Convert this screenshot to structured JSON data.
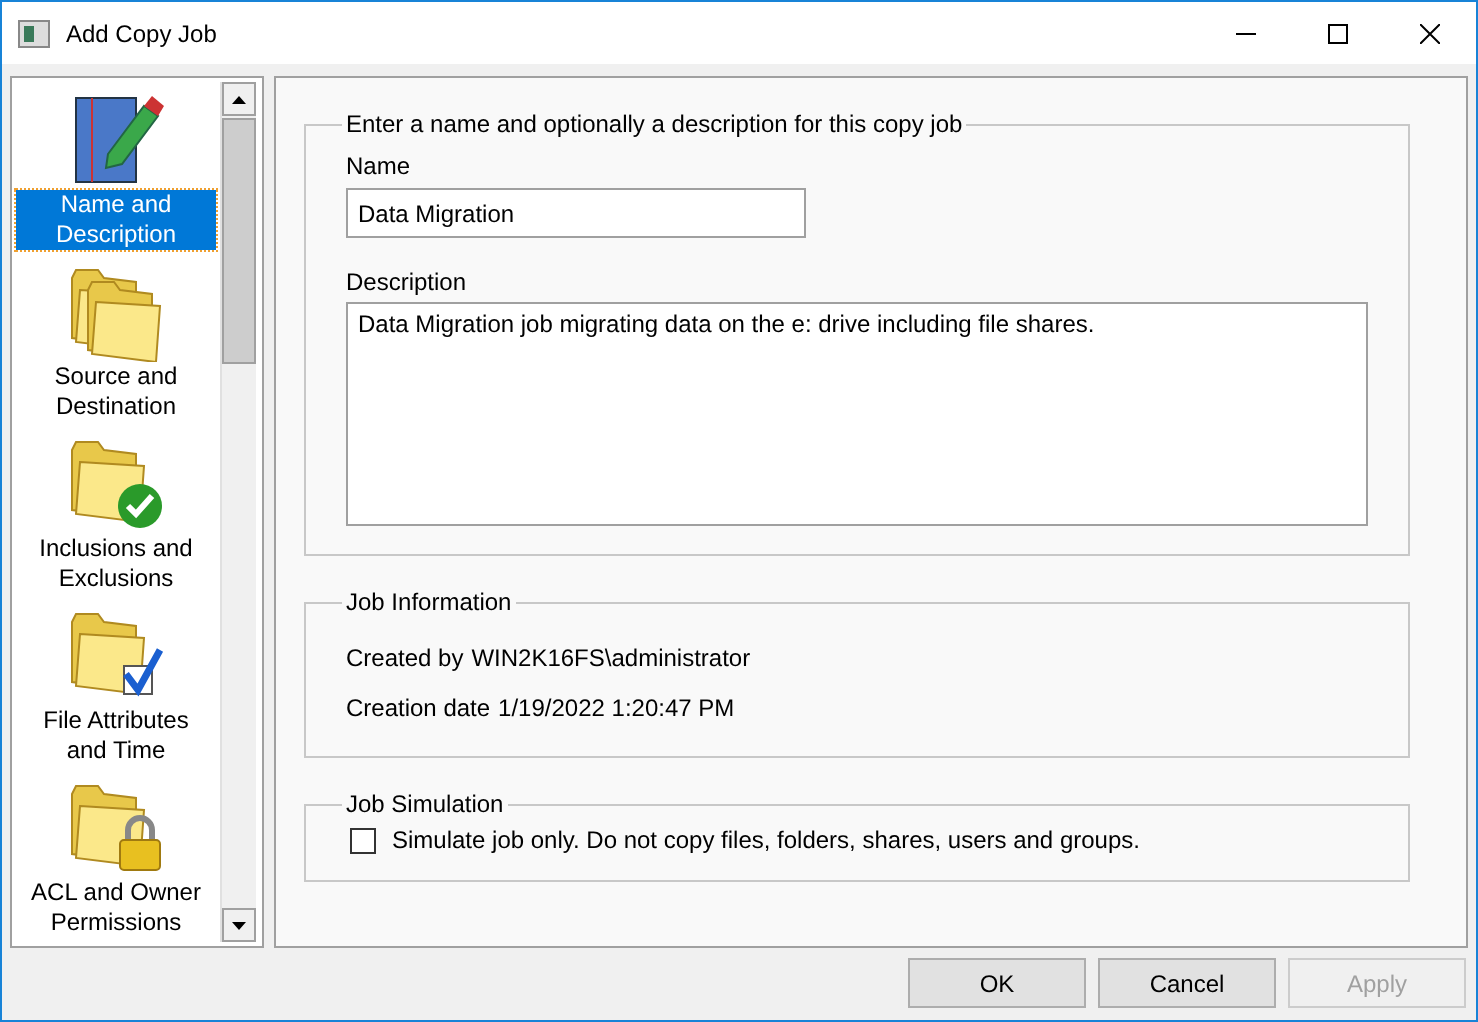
{
  "window": {
    "title": "Add Copy Job"
  },
  "nav": [
    {
      "kind": "notepad",
      "label": "Name and Description",
      "selected": true
    },
    {
      "kind": "folders",
      "label": "Source and Destination",
      "selected": false
    },
    {
      "kind": "folder-check",
      "label": "Inclusions and Exclusions",
      "selected": false
    },
    {
      "kind": "folder-checkbox",
      "label": "File Attributes and Time",
      "selected": false
    },
    {
      "kind": "folder-lock",
      "label": "ACL and Owner Permissions",
      "selected": false
    }
  ],
  "general": {
    "legend": "Enter a name and optionally a description for this copy job",
    "name_label": "Name",
    "name_value": "Data Migration",
    "description_label": "Description",
    "description_value": "Data Migration job migrating data on the e: drive including file shares."
  },
  "job_information": {
    "legend": "Job Information",
    "rows": [
      {
        "label": "Created by",
        "value": "WIN2K16FS\\administrator"
      },
      {
        "label": "Creation date",
        "value": "1/19/2022 1:20:47 PM"
      }
    ]
  },
  "job_simulation": {
    "legend": "Job Simulation",
    "checkbox": {
      "label": "Simulate job only. Do not copy files, folders, shares, users and groups.",
      "checked": false
    }
  },
  "buttons": [
    {
      "label": "OK",
      "disabled": false
    },
    {
      "label": "Cancel",
      "disabled": false
    },
    {
      "label": "Apply",
      "disabled": true
    }
  ]
}
